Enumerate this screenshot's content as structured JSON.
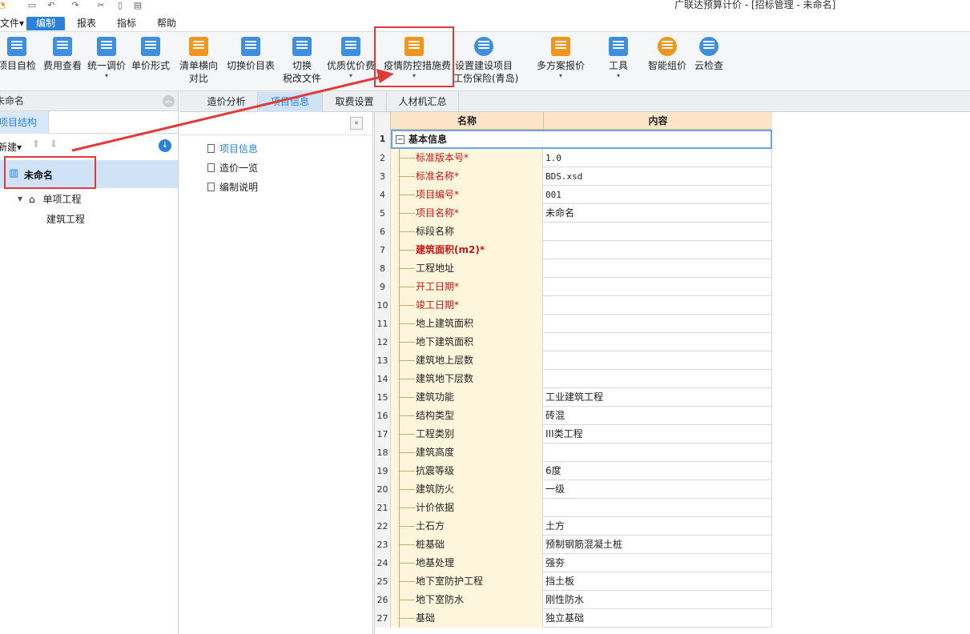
{
  "app": {
    "title": "广联达预算计价 - [招标管理 - 未命名]"
  },
  "quick_access": [
    "save-icon",
    "undo-icon",
    "redo-icon",
    "cut-icon",
    "copy-icon",
    "paste-icon"
  ],
  "menu": {
    "items": [
      "文件▾",
      "编制",
      "报表",
      "指标",
      "帮助"
    ],
    "active": "编制"
  },
  "ribbon": {
    "buttons": [
      {
        "label": "项目自检",
        "icon": "check-project-icon"
      },
      {
        "label": "费用查看",
        "icon": "fee-view-icon"
      },
      {
        "label": "统一调价",
        "icon": "price-adjust-icon",
        "sub": "▾"
      },
      {
        "label": "单价形式",
        "icon": "unit-price-icon"
      },
      {
        "label": "清单横向",
        "label2": "对比",
        "icon": "compare-icon",
        "sub": "▾"
      },
      {
        "label": "切换价目表",
        "icon": "price-table-icon"
      },
      {
        "label": "切换",
        "label2": "税改文件",
        "icon": "tax-file-icon"
      },
      {
        "label": "优质优价费",
        "icon": "quality-fee-icon",
        "sub": "▾"
      },
      {
        "label": "疫情防控措施费",
        "icon": "epidemic-fee-icon",
        "sub": "▾"
      },
      {
        "label": "设置建设项目",
        "label2": "工伤保险(青岛)",
        "icon": "insurance-icon"
      },
      {
        "label": "多方案报价",
        "icon": "multi-plan-icon",
        "sub": "▾"
      },
      {
        "label": "工具",
        "icon": "tools-icon",
        "sub": "▾"
      },
      {
        "label": "智能组价",
        "icon": "smart-price-icon"
      },
      {
        "label": "云检查",
        "icon": "cloud-check-icon"
      }
    ]
  },
  "left_panel": {
    "title": "未命名",
    "tab": "项目结构",
    "new_label": "新建▾",
    "tree": {
      "root": "未命名",
      "child": "单项工程",
      "grandchild": "建筑工程"
    }
  },
  "tabs": {
    "items": [
      "造价分析",
      "项目信息",
      "取费设置",
      "人材机汇总"
    ],
    "active": "项目信息"
  },
  "mid_nav": {
    "items": [
      "项目信息",
      "造价一览",
      "编制说明"
    ],
    "active": "项目信息"
  },
  "grid": {
    "columns": [
      "名称",
      "内容"
    ],
    "group": {
      "num": "1",
      "label": "基本信息",
      "toggle": "−"
    },
    "rows": [
      {
        "num": "2",
        "name": "标准版本号*",
        "value": "1.0",
        "style": "req"
      },
      {
        "num": "3",
        "name": "标准名称*",
        "value": "BDS.xsd",
        "style": "req"
      },
      {
        "num": "4",
        "name": "项目编号*",
        "value": "001",
        "style": "req"
      },
      {
        "num": "5",
        "name": "项目名称*",
        "value": "未命名",
        "style": "req"
      },
      {
        "num": "6",
        "name": "标段名称",
        "value": "",
        "style": ""
      },
      {
        "num": "7",
        "name": "建筑面积(m2)*",
        "value": "",
        "style": "req bold"
      },
      {
        "num": "8",
        "name": "工程地址",
        "value": "",
        "style": ""
      },
      {
        "num": "9",
        "name": "开工日期*",
        "value": "",
        "style": "req"
      },
      {
        "num": "10",
        "name": "竣工日期*",
        "value": "",
        "style": "req"
      },
      {
        "num": "11",
        "name": "地上建筑面积",
        "value": "",
        "style": ""
      },
      {
        "num": "12",
        "name": "地下建筑面积",
        "value": "",
        "style": ""
      },
      {
        "num": "13",
        "name": "建筑地上层数",
        "value": "",
        "style": ""
      },
      {
        "num": "14",
        "name": "建筑地下层数",
        "value": "",
        "style": ""
      },
      {
        "num": "15",
        "name": "建筑功能",
        "value": "工业建筑工程",
        "style": ""
      },
      {
        "num": "16",
        "name": "结构类型",
        "value": "砖混",
        "style": ""
      },
      {
        "num": "17",
        "name": "工程类别",
        "value": "III类工程",
        "style": ""
      },
      {
        "num": "18",
        "name": "建筑高度",
        "value": "",
        "style": ""
      },
      {
        "num": "19",
        "name": "抗震等级",
        "value": "6度",
        "style": ""
      },
      {
        "num": "20",
        "name": "建筑防火",
        "value": "一级",
        "style": ""
      },
      {
        "num": "21",
        "name": "计价依据",
        "value": "",
        "style": ""
      },
      {
        "num": "22",
        "name": "土石方",
        "value": "土方",
        "style": ""
      },
      {
        "num": "23",
        "name": "桩基础",
        "value": "预制钢筋混凝土桩",
        "style": ""
      },
      {
        "num": "24",
        "name": "地基处理",
        "value": "强夯",
        "style": ""
      },
      {
        "num": "25",
        "name": "地下室防护工程",
        "value": "挡土板",
        "style": ""
      },
      {
        "num": "26",
        "name": "地下室防水",
        "value": "刚性防水",
        "style": ""
      },
      {
        "num": "27",
        "name": "基础",
        "value": "独立基础",
        "style": ""
      }
    ]
  },
  "colors": {
    "accent": "#2d82d7",
    "annotation": "#e03a3a",
    "required_text": "#c81818",
    "grid_header": "#fbe4c8",
    "name_cell": "#fdf6dc"
  }
}
